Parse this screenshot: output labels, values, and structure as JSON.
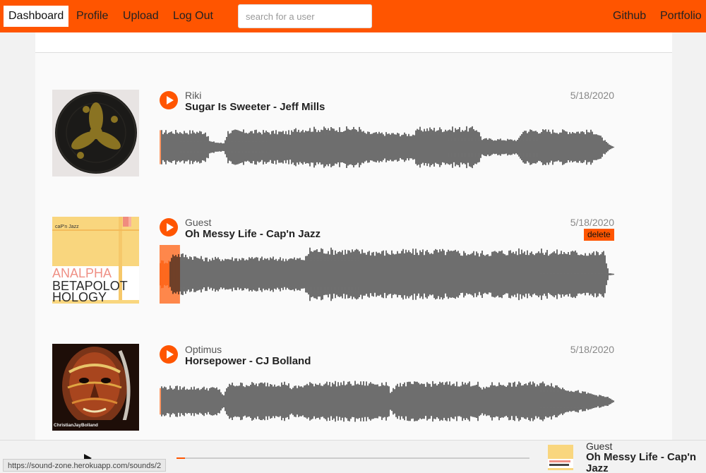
{
  "nav": {
    "dashboard": "Dashboard",
    "profile": "Profile",
    "upload": "Upload",
    "logout": "Log Out",
    "search_placeholder": "search for a user",
    "github": "Github",
    "portfolio": "Portfolio"
  },
  "colors": {
    "accent": "#ff5500",
    "waveform": "#111111",
    "page_bg": "#fafafa"
  },
  "tracks": [
    {
      "uploader": "Riki",
      "title": "Sugar Is Sweeter - Jeff Mills",
      "date": "5/18/2020",
      "cover_icon": "dark-record-artwork",
      "progress": 0
    },
    {
      "uploader": "Guest",
      "title": "Oh Messy Life - Cap'n Jazz",
      "date": "5/18/2020",
      "delete_label": "delete",
      "cover_icon": "analphabetapolothology-artwork",
      "cover_texts": [
        "caP'n Jazz",
        "ANALPHA",
        "BETAPOLOT",
        "HOLOGY"
      ],
      "progress": 0.02
    },
    {
      "uploader": "Optimus",
      "title": "Horsepower - CJ Bolland",
      "date": "5/18/2020",
      "cover_icon": "painted-face-artwork",
      "cover_texts": [
        "ChristianJayBolland"
      ],
      "progress": 0
    }
  ],
  "player": {
    "play_icon": "play-icon",
    "uploader": "Guest",
    "title": "Oh Messy Life - Cap'n Jazz",
    "progress": 0.02
  },
  "statusbar": {
    "url": "https://sound-zone.herokuapp.com/sounds/2"
  }
}
